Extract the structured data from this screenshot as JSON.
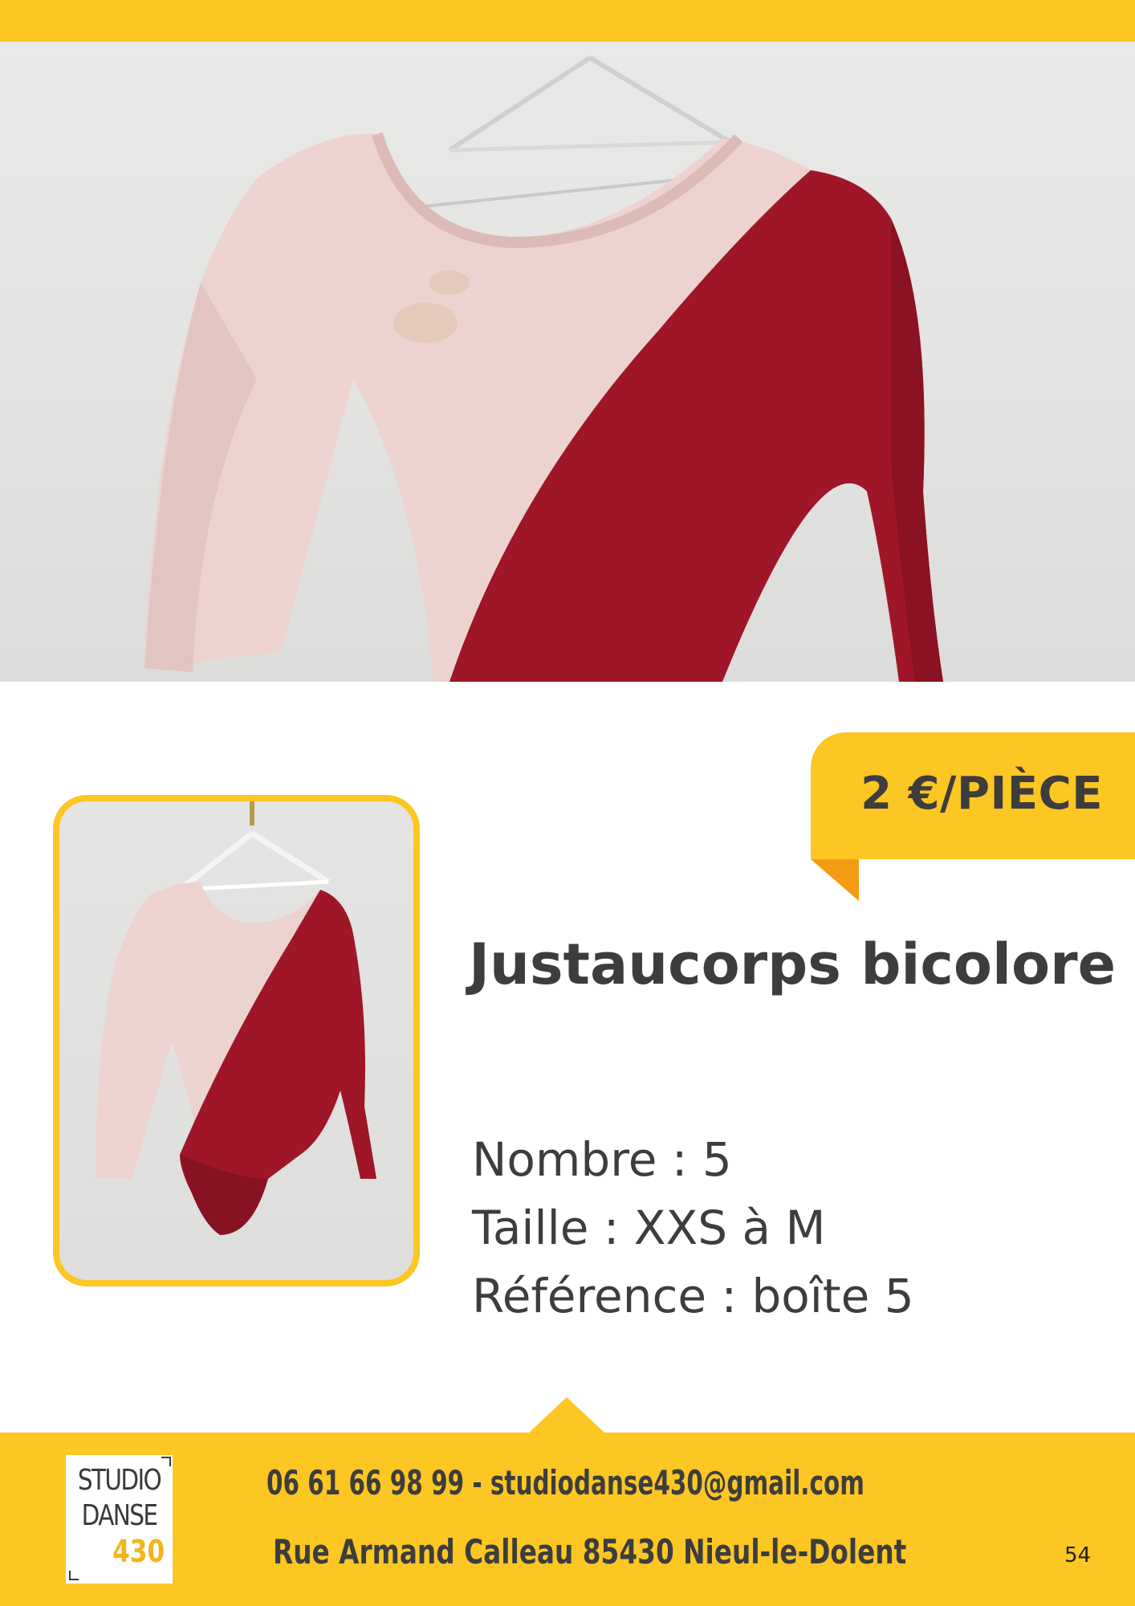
{
  "colors": {
    "accent": "#fcc623",
    "accent_dark": "#f39c12",
    "text": "#3d3d3d",
    "leotard_pink": "#ecd3cf",
    "leotard_red": "#9e1628"
  },
  "hero_image": {
    "icon": "leotard-photo"
  },
  "thumbnail_image": {
    "icon": "leotard-photo"
  },
  "price_tag": {
    "label": "2 €/PIÈCE"
  },
  "product": {
    "title": "Justaucorps bicolore",
    "details": [
      "Nombre : 5",
      "Taille : XXS à M",
      "Référence : boîte 5"
    ]
  },
  "footer": {
    "logo": {
      "line1": "STUDIO",
      "line2": "DANSE",
      "line3": "430"
    },
    "contact": "06 61 66 98 99 - studiodanse430@gmail.com",
    "address": "Rue Armand Calleau 85430 Nieul-le-Dolent",
    "page_number": "54"
  }
}
